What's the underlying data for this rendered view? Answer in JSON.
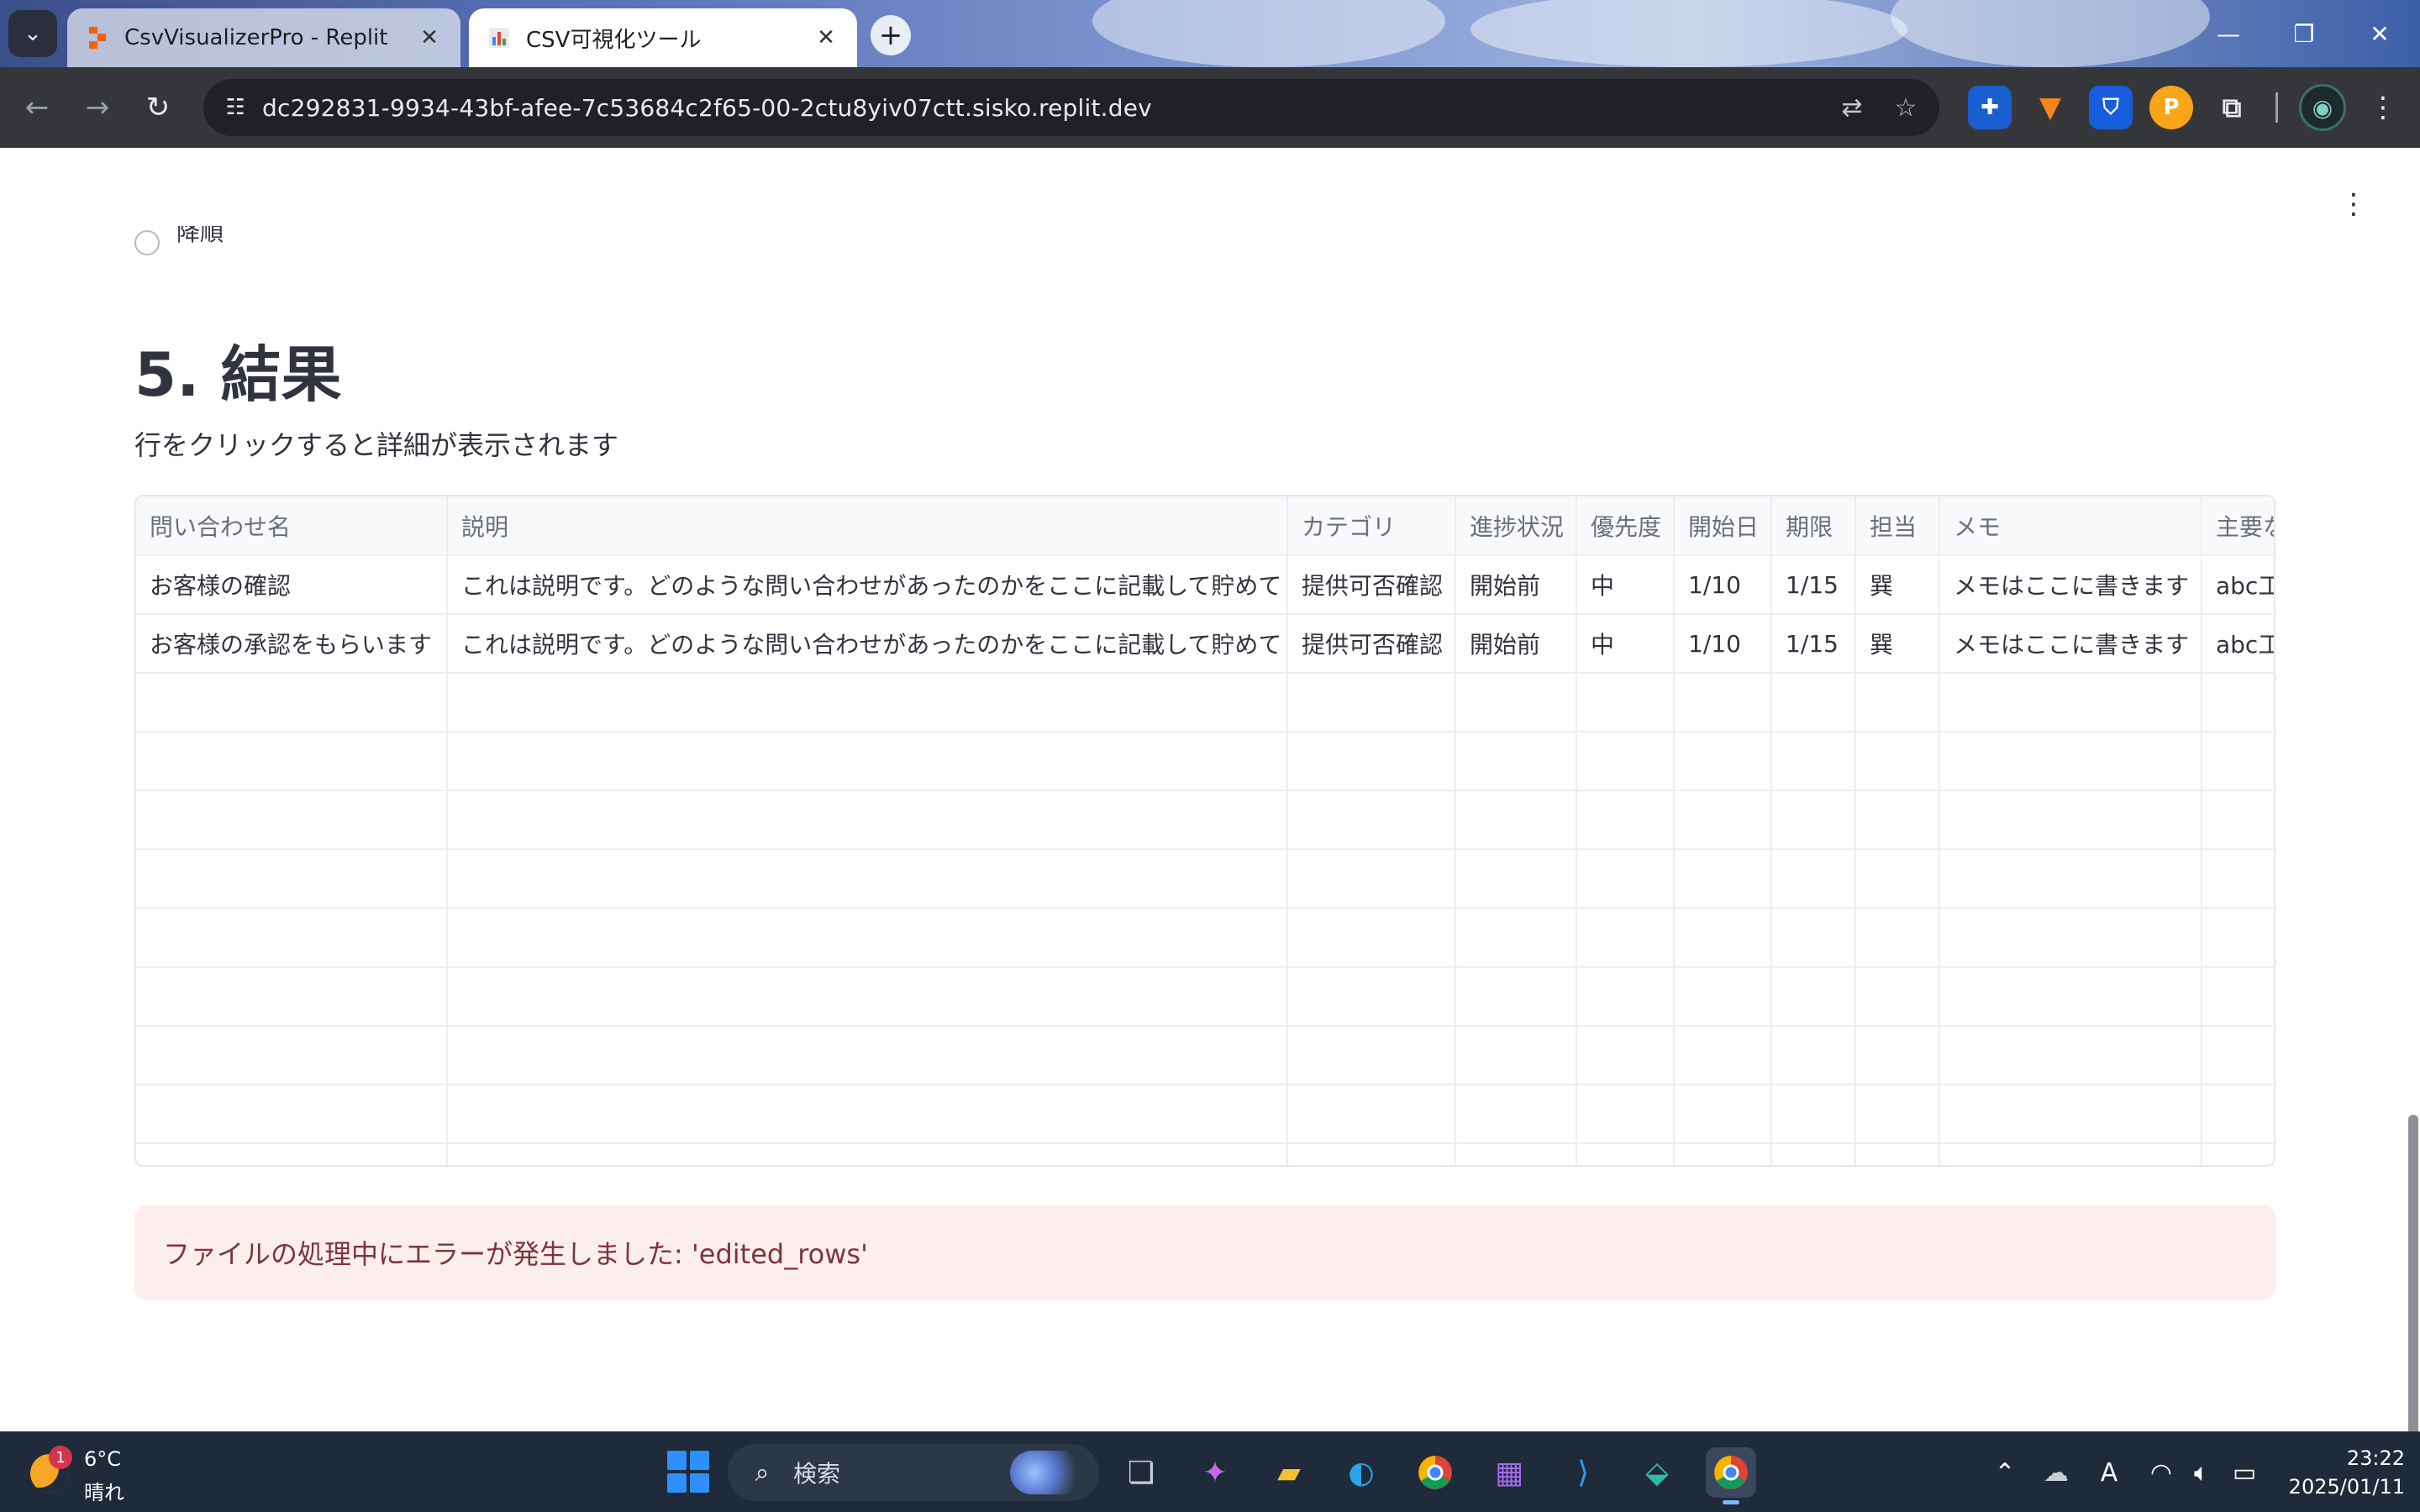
{
  "browser": {
    "tabs": [
      {
        "title": "CsvVisualizerPro - Replit",
        "active": false
      },
      {
        "title": "CSV可視化ツール",
        "active": true
      }
    ],
    "url": "dc292831-9934-43bf-afee-7c53684c2f65-00-2ctu8yiv07ctt.sisko.replit.dev",
    "accent_color": "#ff4b4b"
  },
  "page": {
    "radio_option_label": "降順",
    "section_title": "5. 結果",
    "caption": "行をクリックすると詳細が表示されます",
    "table": {
      "columns": [
        "問い合わせ名",
        "説明",
        "カテゴリ",
        "進捗状況",
        "優先度",
        "開始日",
        "期限",
        "担当",
        "メモ",
        "主要な"
      ],
      "rows": [
        [
          "お客様の確認",
          "これは説明です。どのような問い合わせがあったのかをここに記載して貯めて",
          "提供可否確認",
          "開始前",
          "中",
          "1/10",
          "1/15",
          "巽",
          "メモはここに書きます",
          "abc工"
        ],
        [
          "お客様の承認をもらいます",
          "これは説明です。どのような問い合わせがあったのかをここに記載して貯めて",
          "提供可否確認",
          "開始前",
          "中",
          "1/10",
          "1/15",
          "巽",
          "メモはここに書きます",
          "abc工"
        ]
      ]
    },
    "error_message": "ファイルの処理中にエラーが発生しました: 'edited_rows'"
  },
  "taskbar": {
    "weather": {
      "badge": "1",
      "temperature": "6°C",
      "condition": "晴れ"
    },
    "search_placeholder": "検索",
    "clock": {
      "time": "23:22",
      "date": "2025/01/11"
    }
  }
}
